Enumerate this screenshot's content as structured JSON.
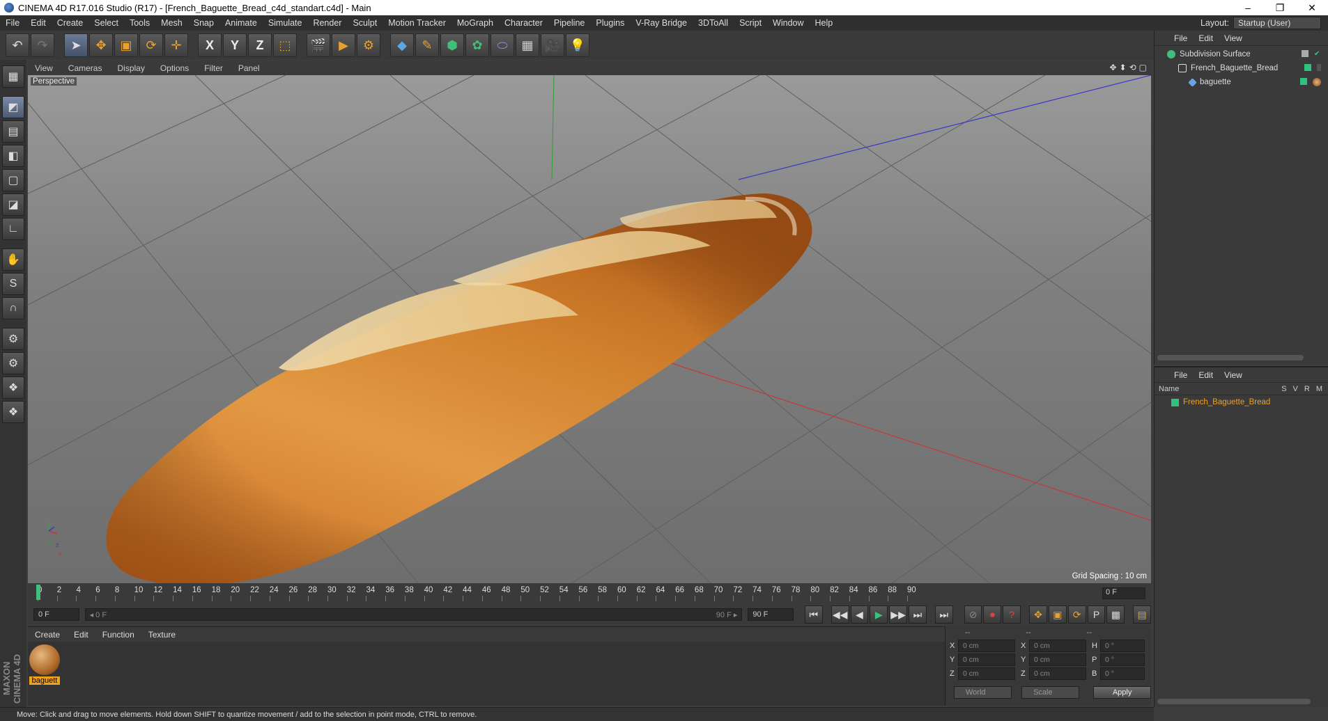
{
  "window": {
    "title": "CINEMA 4D R17.016 Studio (R17) - [French_Baguette_Bread_c4d_standart.c4d] - Main",
    "minimize": "–",
    "restore": "❐",
    "close": "✕"
  },
  "menubar": {
    "items": [
      "File",
      "Edit",
      "Create",
      "Select",
      "Tools",
      "Mesh",
      "Snap",
      "Animate",
      "Simulate",
      "Render",
      "Sculpt",
      "Motion Tracker",
      "MoGraph",
      "Character",
      "Pipeline",
      "Plugins",
      "V-Ray Bridge",
      "3DToAll",
      "Script",
      "Window",
      "Help"
    ],
    "layout_label": "Layout:",
    "layout_value": "Startup (User)"
  },
  "toolbar": {
    "undo": "↶",
    "redo": "↷",
    "select": "➤",
    "move": "✥",
    "scale": "▣",
    "rotate": "⟳",
    "live": "✛",
    "x": "X",
    "y": "Y",
    "z": "Z",
    "coord": "⬚",
    "render_view": "🎬",
    "render": "▶",
    "render_settings": "⚙",
    "cube": "◆",
    "pen": "✎",
    "subdiv": "⬢",
    "cloner": "✿",
    "deformer": "⬭",
    "floor": "▦",
    "camera": "🎥",
    "light": "💡"
  },
  "lefttools": [
    "▦",
    "◩",
    "▤",
    "◧",
    "▢",
    "◪",
    "∟",
    "✋",
    "S",
    "∩",
    "⚙",
    "⚙",
    "❖",
    "❖"
  ],
  "maxon": "MAXON CINEMA 4D",
  "viewport": {
    "menu": [
      "View",
      "Cameras",
      "Display",
      "Options",
      "Filter",
      "Panel"
    ],
    "nav_icons": [
      "✥",
      "⬍",
      "⟲",
      "▢"
    ],
    "label": "Perspective",
    "grid_spacing": "Grid Spacing : 10 cm",
    "axis_y": "y",
    "axis_x": "x",
    "axis_z": "z"
  },
  "timeline": {
    "frames": [
      "0",
      "2",
      "4",
      "6",
      "8",
      "10",
      "12",
      "14",
      "16",
      "18",
      "20",
      "22",
      "24",
      "26",
      "28",
      "30",
      "32",
      "34",
      "36",
      "38",
      "40",
      "42",
      "44",
      "46",
      "48",
      "50",
      "52",
      "54",
      "56",
      "58",
      "60",
      "62",
      "64",
      "66",
      "68",
      "70",
      "72",
      "74",
      "76",
      "78",
      "80",
      "82",
      "84",
      "86",
      "88",
      "90"
    ],
    "current_frame": "0 F"
  },
  "transport": {
    "start": "0 F",
    "range_start": "◂ 0 F",
    "range_end": "90 F ▸",
    "end": "90 F",
    "buttons": [
      "⏮",
      "◀◀",
      "◀",
      "▶",
      "▶▶",
      "⏭",
      "⏭"
    ],
    "key_buttons": [
      "⊘",
      "⏺",
      "?",
      "✥",
      "▣",
      "⟳",
      "P",
      "▦",
      "▤"
    ]
  },
  "material_manager": {
    "menu": [
      "Create",
      "Edit",
      "Function",
      "Texture"
    ],
    "material_name": "baguett"
  },
  "coordinates": {
    "headers": [
      "--",
      "--",
      "--"
    ],
    "rows": [
      {
        "a": "X",
        "av": "0 cm",
        "b": "X",
        "bv": "0 cm",
        "c": "H",
        "cv": "0 °"
      },
      {
        "a": "Y",
        "av": "0 cm",
        "b": "Y",
        "bv": "0 cm",
        "c": "P",
        "cv": "0 °"
      },
      {
        "a": "Z",
        "av": "0 cm",
        "b": "Z",
        "bv": "0 cm",
        "c": "B",
        "cv": "0 °"
      }
    ],
    "mode": "World",
    "scale": "Scale",
    "apply": "Apply"
  },
  "object_manager": {
    "menu": [
      "File",
      "Edit",
      "View"
    ],
    "objects": [
      {
        "name": "Subdivision Surface",
        "color": "#6cc3e8"
      },
      {
        "name": "French_Baguette_Bread",
        "color": "#dddddd"
      },
      {
        "name": "baguette",
        "color": "#6ca0e8"
      }
    ]
  },
  "layer_manager": {
    "menu": [
      "File",
      "Edit",
      "View"
    ],
    "col_name": "Name",
    "cols": [
      "S",
      "V",
      "R",
      "M"
    ],
    "layer": "French_Baguette_Bread",
    "layer_color": "#2ec27e"
  },
  "status": "Move: Click and drag to move elements. Hold down SHIFT to quantize movement / add to the selection in point mode, CTRL to remove."
}
